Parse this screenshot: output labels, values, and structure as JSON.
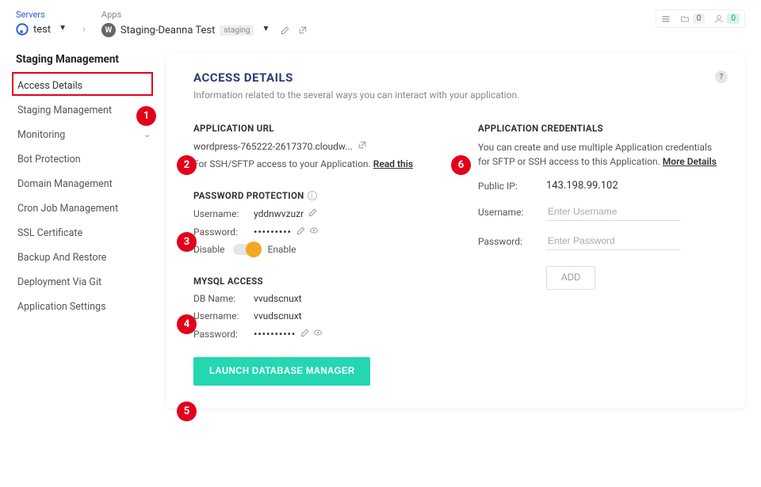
{
  "header": {
    "servers_label": "Servers",
    "server_name": "test",
    "apps_label": "Apps",
    "app_name": "Staging-Deanna Test",
    "app_tag": "staging",
    "right_counts": {
      "a": "0",
      "b": "0"
    }
  },
  "sidebar": {
    "title": "Staging Management",
    "items": [
      "Access Details",
      "Staging Management",
      "Monitoring",
      "Bot Protection",
      "Domain Management",
      "Cron Job Management",
      "SSL Certificate",
      "Backup And Restore",
      "Deployment Via Git",
      "Application Settings"
    ]
  },
  "panel": {
    "title": "ACCESS DETAILS",
    "subtitle": "Information related to the several ways you can interact with your application."
  },
  "app_url": {
    "heading": "APPLICATION URL",
    "url": "wordpress-765222-2617370.cloudw...",
    "ssh_text": "For SSH/SFTP access to your Application.",
    "read_this": "Read this"
  },
  "pwd": {
    "heading": "PASSWORD PROTECTION",
    "username_lbl": "Username:",
    "username_val": "yddnwvzuzr",
    "password_lbl": "Password:",
    "password_val": "•••••••••",
    "disable": "Disable",
    "enable": "Enable"
  },
  "mysql": {
    "heading": "MYSQL ACCESS",
    "dbname_lbl": "DB Name:",
    "dbname_val": "vvudscnuxt",
    "username_lbl": "Username:",
    "username_val": "vvudscnuxt",
    "password_lbl": "Password:",
    "password_val": "••••••••••",
    "launch_btn": "LAUNCH DATABASE MANAGER"
  },
  "creds": {
    "heading": "APPLICATION CREDENTIALS",
    "desc1": "You can create and use multiple Application credentials for SFTP or SSH access to this Application.",
    "more": "More Details",
    "publicip_lbl": "Public IP:",
    "publicip_val": "143.198.99.102",
    "username_lbl": "Username:",
    "username_ph": "Enter Username",
    "password_lbl": "Password:",
    "password_ph": "Enter Password",
    "add_btn": "ADD"
  },
  "annots": {
    "n1": "1",
    "n2": "2",
    "n3": "3",
    "n4": "4",
    "n5": "5",
    "n6": "6"
  }
}
